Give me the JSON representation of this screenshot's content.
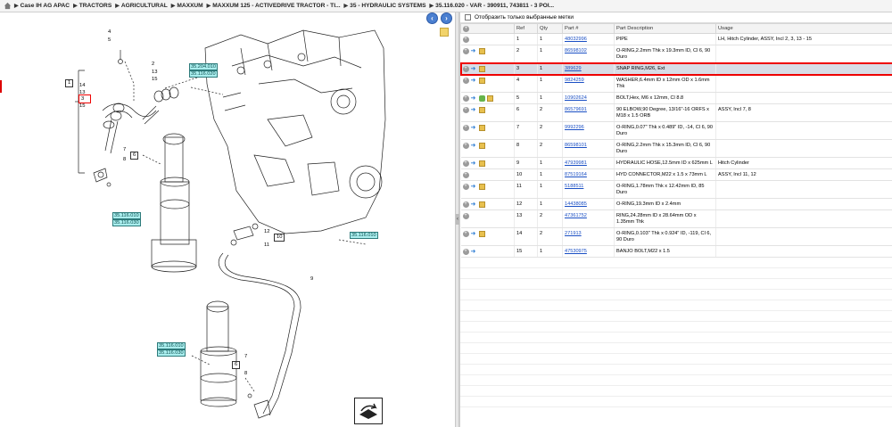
{
  "breadcrumb": {
    "items": [
      "Case IH AG APAC",
      "TRACTORS",
      "AGRICULTURAL",
      "MAXXUM",
      "MAXXUM 125 - ACTIVEDRIVE TRACTOR - TI...",
      "35 - HYDRAULIC SYSTEMS",
      "35.116.020 - VAR - 390911, 743811 - 3 POI..."
    ]
  },
  "filter": {
    "label": "Отобразить только выбранные метки"
  },
  "table": {
    "headers": [
      "Ref",
      "Qty",
      "Part #",
      "Part Description",
      "Usage"
    ],
    "rows": [
      {
        "ref": "1",
        "qty": "1",
        "part": "48032996",
        "desc": "PIPE",
        "usage": "LH, Hitch Cylinder, ASSY, Incl 2, 3, 13 - 15",
        "icons": "plus"
      },
      {
        "ref": "2",
        "qty": "1",
        "part": "86598102",
        "desc": "O-RING,2.2mm Thk x 19.3mm ID, Cl 6, 90 Duro",
        "usage": "",
        "icons": "plus-arrow-box"
      },
      {
        "ref": "3",
        "qty": "1",
        "part": "389629",
        "desc": "SNAP RING,M26, Ext",
        "usage": "",
        "icons": "plus-arrow-box"
      },
      {
        "ref": "4",
        "qty": "1",
        "part": "9824259",
        "desc": "WASHER,6.4mm ID x 12mm OD x 1.6mm Thk",
        "usage": "",
        "icons": "plus-arrow-box"
      },
      {
        "ref": "5",
        "qty": "1",
        "part": "10902624",
        "desc": "BOLT,Hex, M6 x 12mm, Cl 8.8",
        "usage": "",
        "icons": "plus-arrow-leaf-box"
      },
      {
        "ref": "6",
        "qty": "2",
        "part": "86579691",
        "desc": "90 ELBOW,90 Degree, 13/16\"-16 ORFS x M18 x 1.5 ORB",
        "usage": "ASSY, Incl 7, 8",
        "icons": "plus-arrow-box"
      },
      {
        "ref": "7",
        "qty": "2",
        "part": "9992296",
        "desc": "O-RING,0.07\" Thk x 0.489\" ID, -14, Cl 6, 90 Duro",
        "usage": "",
        "icons": "plus-arrow-box"
      },
      {
        "ref": "8",
        "qty": "2",
        "part": "86598101",
        "desc": "O-RING,2.2mm Thk x 15.3mm ID, Cl 6, 90 Duro",
        "usage": "",
        "icons": "plus-arrow-box"
      },
      {
        "ref": "9",
        "qty": "1",
        "part": "47939981",
        "desc": "HYDRAULIC HOSE,12.5mm ID x 625mm L",
        "usage": "Hitch Cylinder",
        "icons": "plus-arrow-box"
      },
      {
        "ref": "10",
        "qty": "1",
        "part": "87519164",
        "desc": "HYD CONNECTOR,M22 x 1.5 x 73mm L",
        "usage": "ASSY, Incl 11, 12",
        "icons": "plus"
      },
      {
        "ref": "11",
        "qty": "1",
        "part": "5188511",
        "desc": "O-RING,1.78mm Thk x 12.42mm ID, 85 Duro",
        "usage": "",
        "icons": "plus-arrow-box"
      },
      {
        "ref": "12",
        "qty": "1",
        "part": "14438085",
        "desc": "O-RING,19.3mm ID x 2.4mm",
        "usage": "",
        "icons": "plus-arrow-box"
      },
      {
        "ref": "13",
        "qty": "2",
        "part": "47361752",
        "desc": "RING,24.28mm ID x 28.64mm OD x 1.35mm Thk",
        "usage": "",
        "icons": "plus"
      },
      {
        "ref": "14",
        "qty": "2",
        "part": "271913",
        "desc": "O-RING,0.103\" Thk x 0.924\" ID, -119, Cl 6, 90 Duro",
        "usage": "",
        "icons": "plus-arrow-box"
      },
      {
        "ref": "15",
        "qty": "1",
        "part": "47530975",
        "desc": "BANJO BOLT,M22 x 1.5",
        "usage": "",
        "icons": "plus-arrow"
      }
    ]
  },
  "diagram": {
    "callouts": [
      "4",
      "5",
      "2",
      "13",
      "15",
      "1",
      "14",
      "13",
      "3",
      "15",
      "7",
      "6",
      "8",
      "12",
      "10",
      "11",
      "9",
      "6",
      "7",
      "8"
    ],
    "tags": [
      "35.204.010",
      "35.116.020",
      "35.116.010",
      "35.116.030",
      "35.116.010",
      "35.116.010",
      "35.116.030"
    ]
  }
}
